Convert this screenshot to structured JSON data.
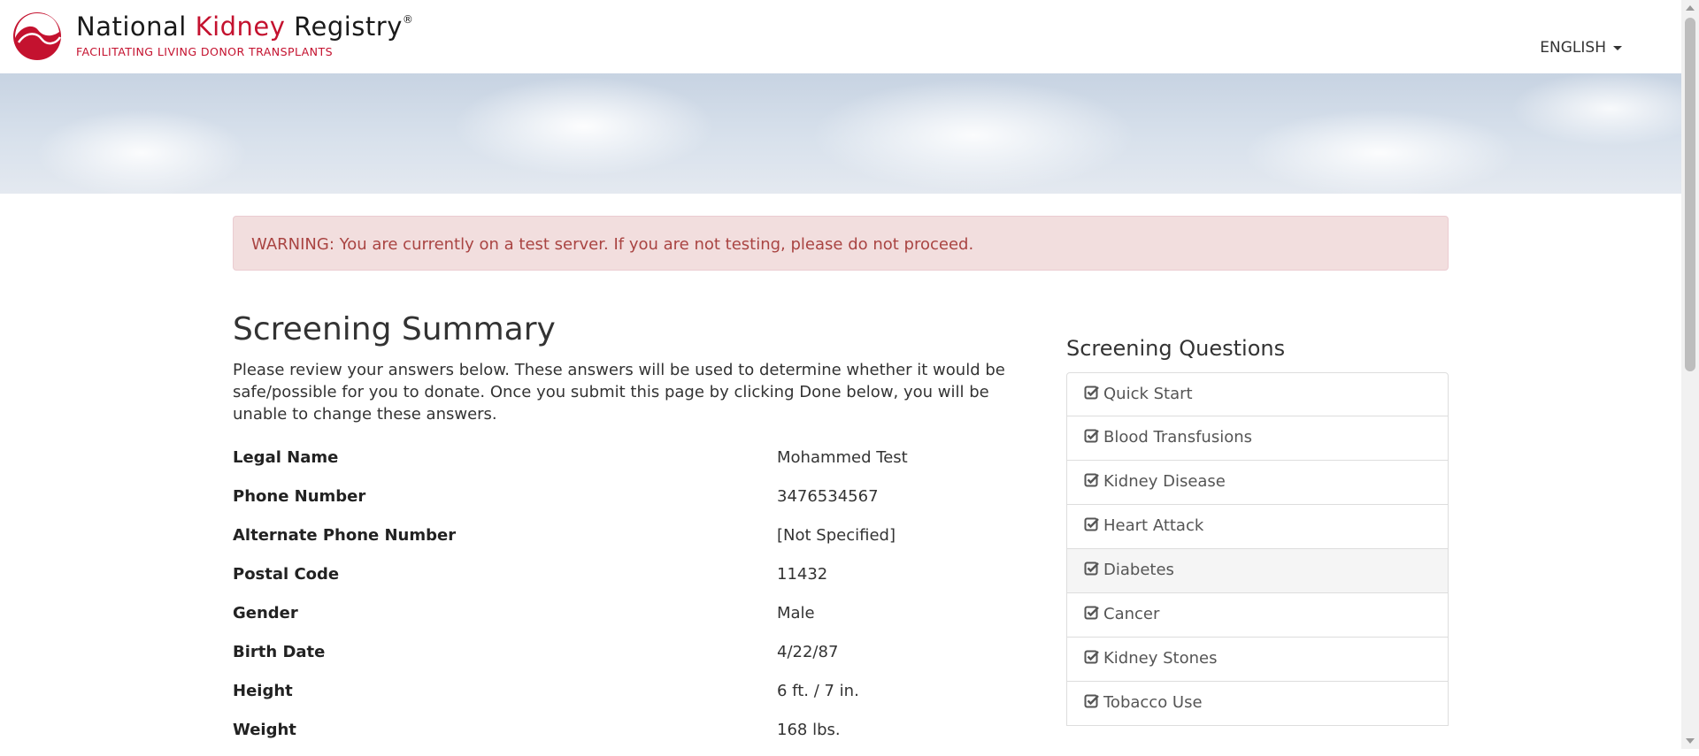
{
  "header": {
    "brand_part1": "National ",
    "brand_part2": "Kidney",
    "brand_part3": " Registry",
    "brand_reg": "®",
    "tagline": "FACILITATING LIVING DONOR TRANSPLANTS",
    "language": "ENGLISH",
    "brand_red": "#c4122f"
  },
  "alert": {
    "text": "WARNING: You are currently on a test server. If you are not testing, please do not proceed."
  },
  "main": {
    "title": "Screening Summary",
    "intro": "Please review your answers below. These answers will be used to determine whether it would be safe/possible for you to donate. Once you submit this page by clicking Done below, you will be unable to change these answers.",
    "summary": [
      {
        "label": "Legal Name",
        "value": "Mohammed Test"
      },
      {
        "label": "Phone Number",
        "value": "3476534567"
      },
      {
        "label": "Alternate Phone Number",
        "value": "[Not Specified]"
      },
      {
        "label": "Postal Code",
        "value": "11432"
      },
      {
        "label": "Gender",
        "value": "Male"
      },
      {
        "label": "Birth Date",
        "value": "4/22/87"
      },
      {
        "label": "Height",
        "value": "6 ft. / 7 in."
      },
      {
        "label": "Weight",
        "value": "168 lbs."
      }
    ]
  },
  "sidebar": {
    "title": "Screening Questions",
    "items": [
      {
        "label": "Quick Start",
        "icon": "check-square-icon"
      },
      {
        "label": "Blood Transfusions",
        "icon": "check-square-icon"
      },
      {
        "label": "Kidney Disease",
        "icon": "check-square-icon"
      },
      {
        "label": "Heart Attack",
        "icon": "check-square-icon"
      },
      {
        "label": "Diabetes",
        "icon": "check-square-icon",
        "active": true
      },
      {
        "label": "Cancer",
        "icon": "check-square-icon"
      },
      {
        "label": "Kidney Stones",
        "icon": "check-square-icon"
      },
      {
        "label": "Tobacco Use",
        "icon": "check-square-icon"
      }
    ]
  }
}
